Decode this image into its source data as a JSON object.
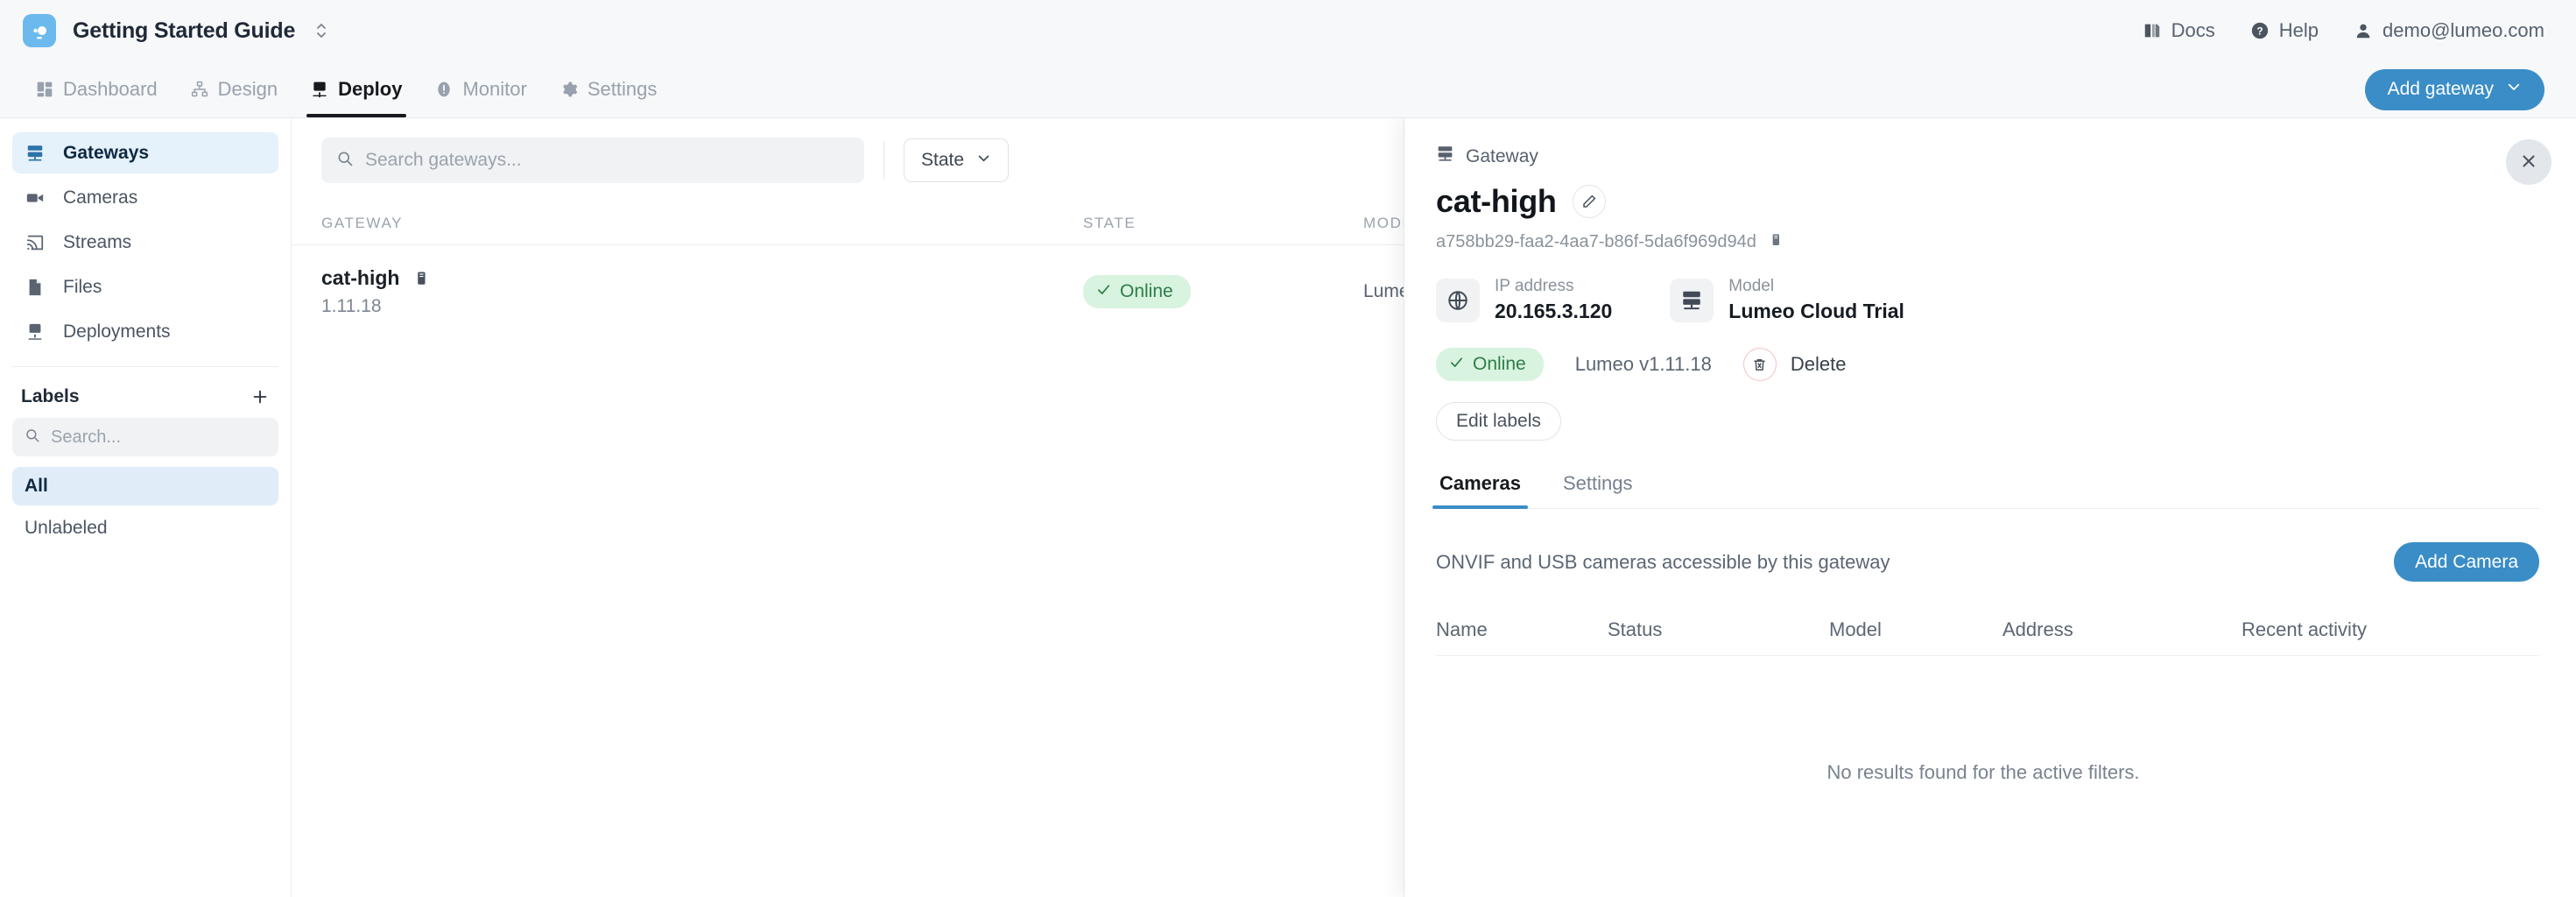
{
  "topbar": {
    "logo_icon": "lumeo-camera-logo-icon",
    "workspace": "Getting Started Guide",
    "workspace_switch_icon": "chevron-up-down-icon",
    "links": [
      {
        "label": "Docs",
        "icon": "book-icon"
      },
      {
        "label": "Help",
        "icon": "question-circle-icon"
      },
      {
        "label": "demo@lumeo.com",
        "icon": "person-icon"
      }
    ]
  },
  "navbar": {
    "items": [
      {
        "label": "Dashboard",
        "icon": "dashboard-grid-icon",
        "active": false
      },
      {
        "label": "Design",
        "icon": "sitemap-icon",
        "active": false
      },
      {
        "label": "Deploy",
        "icon": "deploy-upload-icon",
        "active": true
      },
      {
        "label": "Monitor",
        "icon": "alert-circle-icon",
        "active": false
      },
      {
        "label": "Settings",
        "icon": "gear-icon",
        "active": false
      }
    ],
    "add_gateway_label": "Add gateway",
    "add_gateway_chevron_icon": "chevron-down-icon"
  },
  "sidebar": {
    "items": [
      {
        "label": "Gateways",
        "icon": "server-icon",
        "active": true
      },
      {
        "label": "Cameras",
        "icon": "video-camera-icon",
        "active": false
      },
      {
        "label": "Streams",
        "icon": "cast-stream-icon",
        "active": false
      },
      {
        "label": "Files",
        "icon": "file-icon",
        "active": false
      },
      {
        "label": "Deployments",
        "icon": "deploy-upload-icon",
        "active": false
      }
    ],
    "labels_title": "Labels",
    "labels_add_icon": "plus-icon",
    "labels_search_placeholder": "Search...",
    "labels_search_value": "",
    "labels_search_icon": "search-icon",
    "label_items": [
      {
        "label": "All",
        "active": true
      },
      {
        "label": "Unlabeled",
        "active": false
      }
    ]
  },
  "main": {
    "search_placeholder": "Search gateways...",
    "search_value": "",
    "search_icon": "search-icon",
    "state_filter_label": "State",
    "state_filter_icon": "chevron-down-icon",
    "columns": [
      "GATEWAY",
      "STATE",
      "MODEL"
    ],
    "rows": [
      {
        "name": "cat-high",
        "version": "1.11.18",
        "copy_icon": "copy-icon",
        "state": "Online",
        "state_icon": "check-icon",
        "model": "Lumeo"
      }
    ]
  },
  "drawer": {
    "breadcrumb": "Gateway",
    "breadcrumb_icon": "server-icon",
    "close_icon": "close-icon",
    "title": "cat-high",
    "edit_icon": "pencil-icon",
    "uuid": "a758bb29-faa2-4aa7-b86f-5da6f969d94d",
    "uuid_copy_icon": "copy-icon",
    "info": [
      {
        "label": "IP address",
        "value": "20.165.3.120",
        "icon": "globe-icon"
      },
      {
        "label": "Model",
        "value": "Lumeo Cloud Trial",
        "icon": "server-icon"
      }
    ],
    "status": "Online",
    "status_icon": "check-icon",
    "version": "Lumeo v1.11.18",
    "delete_label": "Delete",
    "delete_icon": "trash-icon",
    "edit_labels_label": "Edit labels",
    "tabs": [
      {
        "label": "Cameras",
        "active": true
      },
      {
        "label": "Settings",
        "active": false
      }
    ],
    "section_description": "ONVIF and USB cameras accessible by this gateway",
    "add_camera_label": "Add Camera",
    "camera_columns": [
      "Name",
      "Status",
      "Model",
      "Address",
      "Recent activity"
    ],
    "empty_message": "No results found for the active filters."
  },
  "colors": {
    "accent": "#3a8dc7",
    "online_bg": "#d8f3df",
    "online_text": "#2e7d47",
    "sidebar_active_bg": "#e5f1fb",
    "topbar_bg": "#f7f8f9",
    "logo_bg": "#6cb9ee"
  }
}
